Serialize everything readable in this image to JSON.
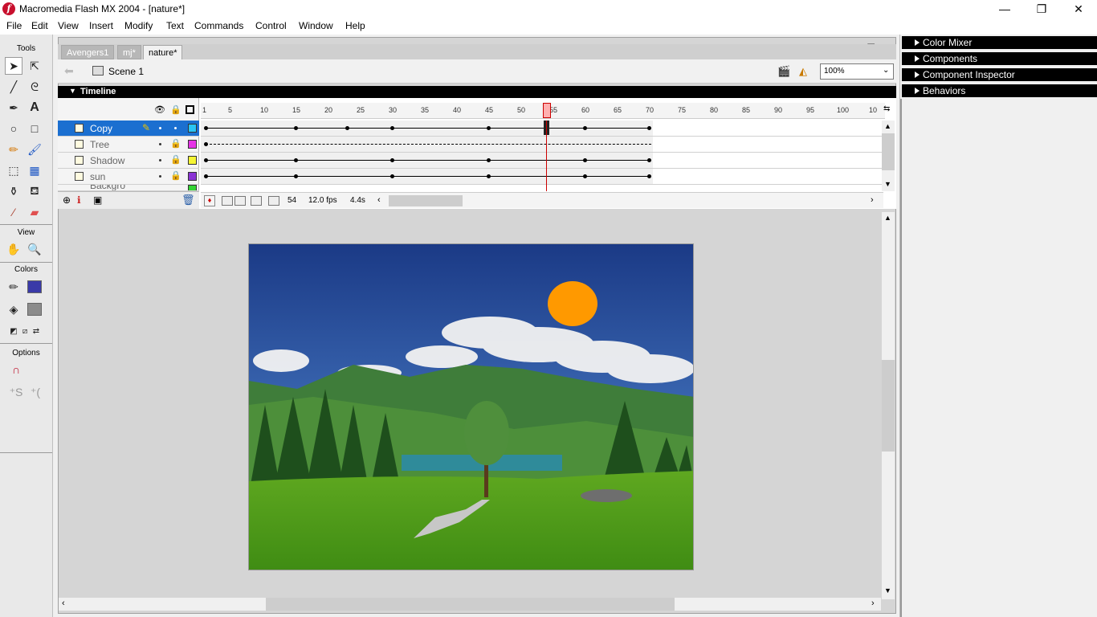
{
  "window": {
    "title": "Macromedia Flash MX 2004 - [nature*]",
    "icon_letter": "f",
    "minimize": "—",
    "maximize": "❐",
    "close": "✕"
  },
  "menu": [
    "File",
    "Edit",
    "View",
    "Insert",
    "Modify",
    "Text",
    "Commands",
    "Control",
    "Window",
    "Help"
  ],
  "tools": {
    "heading": "Tools",
    "view_heading": "View",
    "colors_heading": "Colors",
    "options_heading": "Options",
    "stroke_color": "#3a3aa8",
    "fill_color": "#8c8c8c"
  },
  "tabs": [
    {
      "label": "Avengers1",
      "active": false
    },
    {
      "label": "mj*",
      "active": false
    },
    {
      "label": "nature*",
      "active": true
    }
  ],
  "scene": {
    "label": "Scene 1",
    "zoom": "100%"
  },
  "timeline": {
    "header": "Timeline",
    "ruler_ticks": [
      "1",
      "5",
      "10",
      "15",
      "20",
      "25",
      "30",
      "35",
      "40",
      "45",
      "50",
      "55",
      "60",
      "65",
      "70",
      "75",
      "80",
      "85",
      "90",
      "95",
      "100",
      "10"
    ],
    "current_frame": "54",
    "fps": "12.0 fps",
    "elapsed": "4.4s",
    "layers": [
      {
        "name": "Copy",
        "selected": true,
        "color": "#29c4f5"
      },
      {
        "name": "Tree",
        "selected": false,
        "color": "#e633e6"
      },
      {
        "name": "Shadow",
        "selected": false,
        "color": "#f5f533"
      },
      {
        "name": "sun",
        "selected": false,
        "color": "#8a33d4"
      },
      {
        "name": "Backgro",
        "selected": false,
        "color": "#33d433"
      }
    ]
  },
  "panels": [
    "Color Mixer",
    "Components",
    "Component Inspector",
    "Behaviors"
  ],
  "stage": {
    "sun_color": "#ff9900",
    "shadow_color": "#6e6e6e"
  }
}
